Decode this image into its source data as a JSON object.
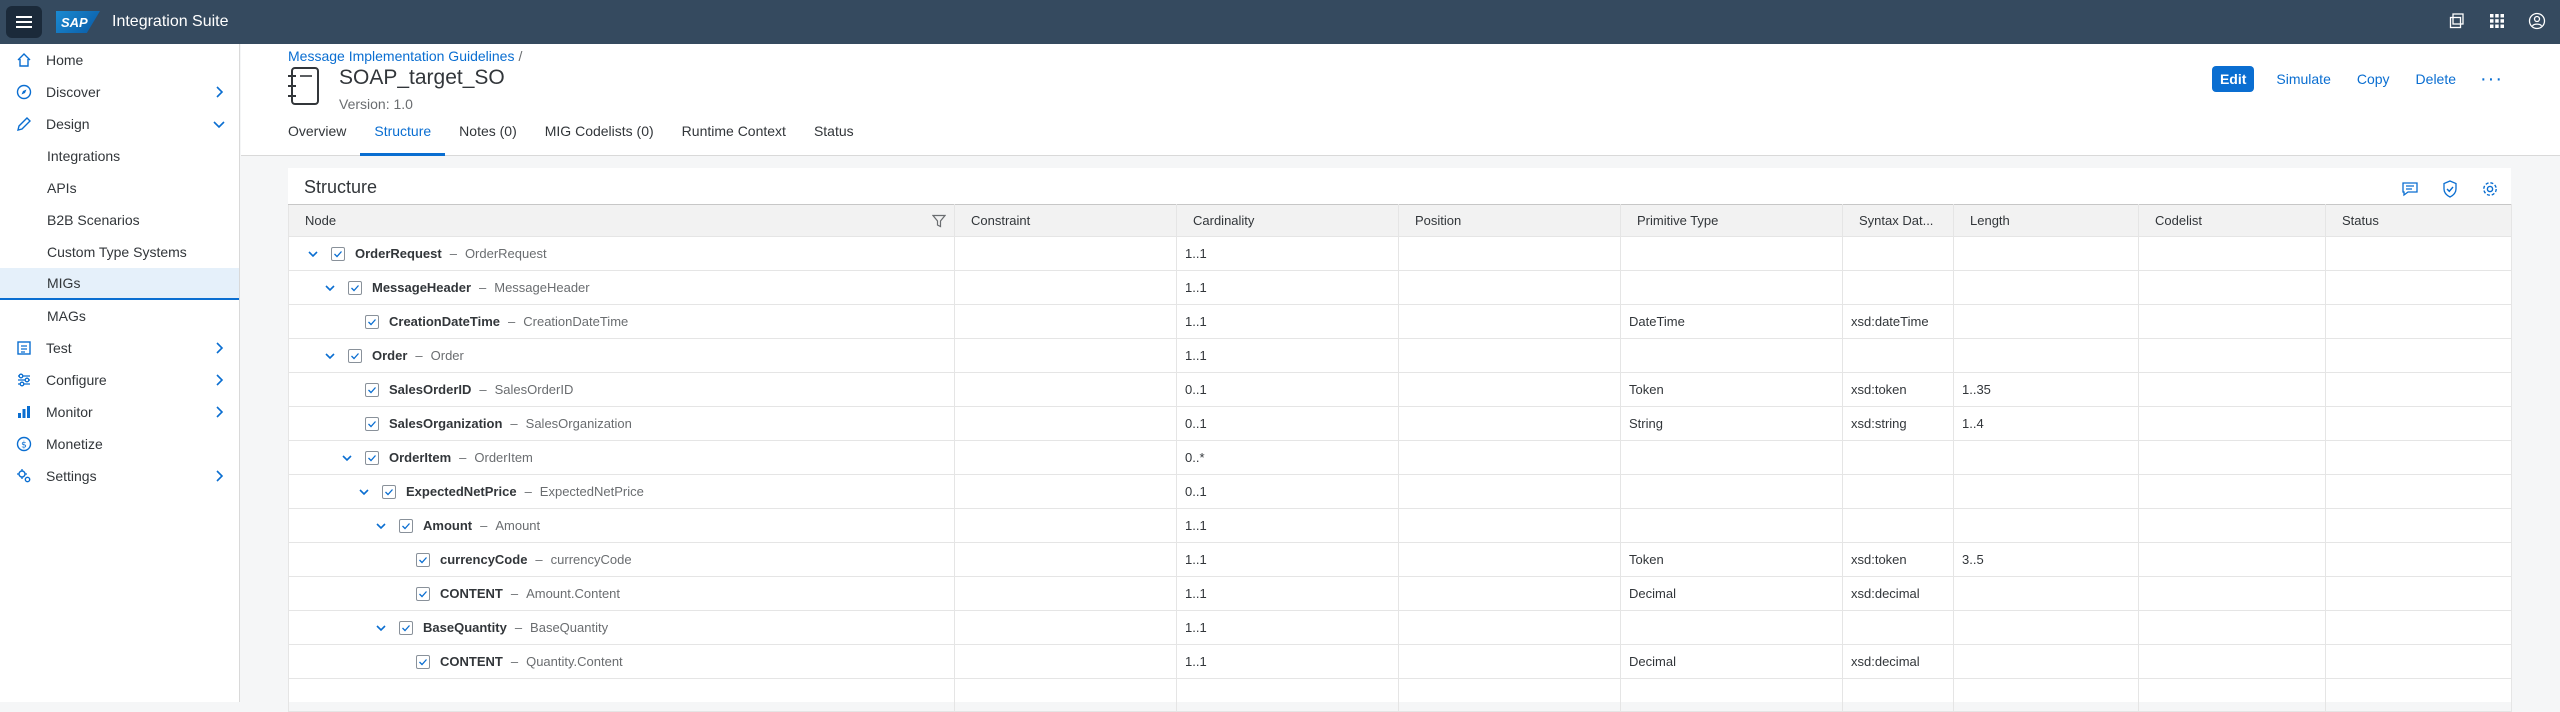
{
  "shell": {
    "app_title": "Integration Suite",
    "logo_text": "SAP"
  },
  "sidebar": {
    "items": [
      {
        "label": "Home",
        "icon": "home-icon"
      },
      {
        "label": "Discover",
        "icon": "compass-icon"
      },
      {
        "label": "Design",
        "icon": "pencil-icon"
      },
      {
        "label": "Integrations"
      },
      {
        "label": "APIs"
      },
      {
        "label": "B2B Scenarios"
      },
      {
        "label": "Custom Type Systems"
      },
      {
        "label": "MIGs"
      },
      {
        "label": "MAGs"
      },
      {
        "label": "Test",
        "icon": "test-icon"
      },
      {
        "label": "Configure",
        "icon": "configure-icon"
      },
      {
        "label": "Monitor",
        "icon": "monitor-icon"
      },
      {
        "label": "Monetize",
        "icon": "monetize-icon"
      },
      {
        "label": "Settings",
        "icon": "settings-icon"
      }
    ]
  },
  "header": {
    "breadcrumb": "Message Implementation Guidelines",
    "breadcrumb_sep": "/",
    "title": "SOAP_target_SO",
    "version": "Version: 1.0",
    "actions": {
      "edit": "Edit",
      "simulate": "Simulate",
      "copy": "Copy",
      "delete": "Delete",
      "more": "···"
    }
  },
  "tabs": [
    "Overview",
    "Structure",
    "Notes (0)",
    "MIG Codelists (0)",
    "Runtime Context",
    "Status"
  ],
  "structure": {
    "title": "Structure",
    "columns": [
      "Node",
      "Constraint",
      "Cardinality",
      "Position",
      "Primitive Type",
      "Syntax Dat...",
      "Length",
      "Codelist",
      "Status"
    ],
    "rows": [
      {
        "level": 0,
        "expandable": true,
        "name": "OrderRequest",
        "label": "OrderRequest",
        "cardinality": "1..1",
        "primitive": "",
        "syntax": "",
        "length": ""
      },
      {
        "level": 1,
        "expandable": true,
        "name": "MessageHeader",
        "label": "MessageHeader",
        "cardinality": "1..1",
        "primitive": "",
        "syntax": "",
        "length": ""
      },
      {
        "level": 2,
        "expandable": false,
        "name": "CreationDateTime",
        "label": "CreationDateTime",
        "cardinality": "1..1",
        "primitive": "DateTime",
        "syntax": "xsd:dateTime",
        "length": ""
      },
      {
        "level": 1,
        "expandable": true,
        "name": "Order",
        "label": "Order",
        "cardinality": "1..1",
        "primitive": "",
        "syntax": "",
        "length": ""
      },
      {
        "level": 2,
        "expandable": false,
        "name": "SalesOrderID",
        "label": "SalesOrderID",
        "cardinality": "0..1",
        "primitive": "Token",
        "syntax": "xsd:token",
        "length": "1..35"
      },
      {
        "level": 2,
        "expandable": false,
        "name": "SalesOrganization",
        "label": "SalesOrganization",
        "cardinality": "0..1",
        "primitive": "String",
        "syntax": "xsd:string",
        "length": "1..4"
      },
      {
        "level": 2,
        "expandable": true,
        "name": "OrderItem",
        "label": "OrderItem",
        "cardinality": "0..*",
        "primitive": "",
        "syntax": "",
        "length": ""
      },
      {
        "level": 3,
        "expandable": true,
        "name": "ExpectedNetPrice",
        "label": "ExpectedNetPrice",
        "cardinality": "0..1",
        "primitive": "",
        "syntax": "",
        "length": ""
      },
      {
        "level": 4,
        "expandable": true,
        "name": "Amount",
        "label": "Amount",
        "cardinality": "1..1",
        "primitive": "",
        "syntax": "",
        "length": ""
      },
      {
        "level": 5,
        "expandable": false,
        "name": "currencyCode",
        "label": "currencyCode",
        "cardinality": "1..1",
        "primitive": "Token",
        "syntax": "xsd:token",
        "length": "3..5"
      },
      {
        "level": 5,
        "expandable": false,
        "name": "CONTENT",
        "label": "Amount.Content",
        "cardinality": "1..1",
        "primitive": "Decimal",
        "syntax": "xsd:decimal",
        "length": ""
      },
      {
        "level": 4,
        "expandable": true,
        "name": "BaseQuantity",
        "label": "BaseQuantity",
        "cardinality": "1..1",
        "primitive": "",
        "syntax": "",
        "length": ""
      },
      {
        "level": 5,
        "expandable": false,
        "name": "CONTENT",
        "label": "Quantity.Content",
        "cardinality": "1..1",
        "primitive": "Decimal",
        "syntax": "xsd:decimal",
        "length": ""
      }
    ]
  },
  "colors": {
    "shell": "#354a5f",
    "accent": "#0a6ed1",
    "selected_nav": "#e5f0fa"
  }
}
